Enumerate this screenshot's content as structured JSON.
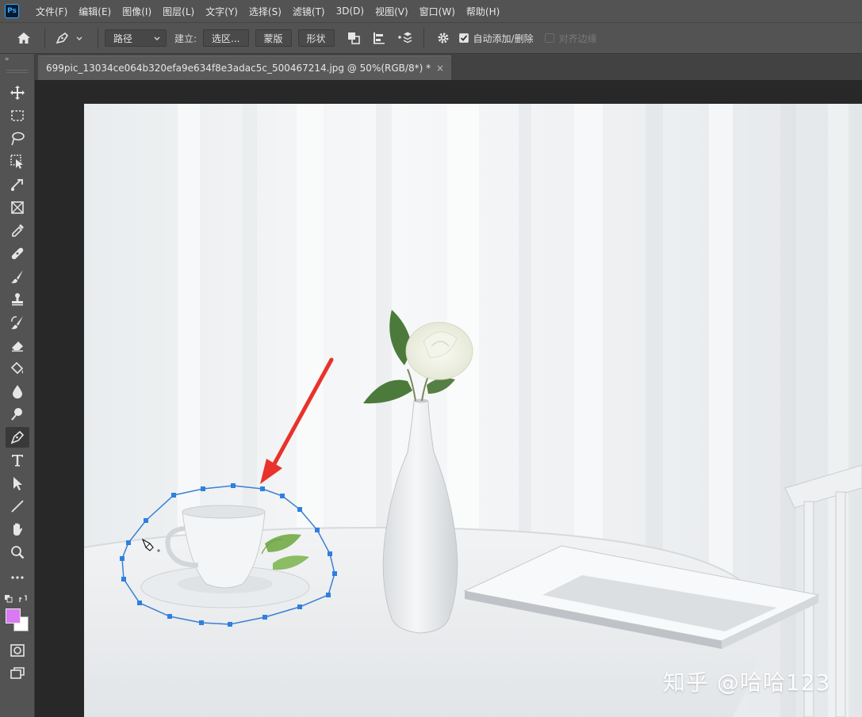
{
  "app": {
    "logo": "Ps",
    "accent": "#31a8ff"
  },
  "menu": [
    "文件(F)",
    "编辑(E)",
    "图像(I)",
    "图层(L)",
    "文字(Y)",
    "选择(S)",
    "滤镜(T)",
    "3D(D)",
    "视图(V)",
    "窗口(W)",
    "帮助(H)"
  ],
  "options": {
    "mode_select": "路径",
    "build_label": "建立:",
    "selection_button": "选区...",
    "mask_button": "蒙版",
    "shape_button": "形状",
    "auto_add_delete_label": "自动添加/删除",
    "auto_add_delete_checked": true,
    "align_edges_label": "对齐边缘",
    "align_edges_checked": false
  },
  "toolbar": {
    "collapse_label": "»",
    "tools": [
      "move-tool-icon",
      "marquee-tool-icon",
      "lasso-tool-icon",
      "object-selection-tool-icon",
      "crop-tool-icon",
      "frame-tool-icon",
      "eyedropper-tool-icon",
      "healing-brush-tool-icon",
      "brush-tool-icon",
      "clone-stamp-tool-icon",
      "history-brush-tool-icon",
      "eraser-tool-icon",
      "paint-bucket-tool-icon",
      "blur-tool-icon",
      "dodge-tool-icon",
      "pen-tool-icon",
      "type-tool-icon",
      "path-selection-tool-icon",
      "line-tool-icon",
      "hand-tool-icon",
      "zoom-tool-icon",
      "more-tools-icon"
    ],
    "active_tool": "pen-tool-icon",
    "foreground_color": "#d97af2",
    "background_color": "#ffffff"
  },
  "document": {
    "tab_title": "699pic_13034ce064b320efa9e634f8e3adac5c_500467214.jpg @ 50%(RGB/8*) *",
    "close_glyph": "×"
  },
  "path_color": "#3a7fd4",
  "arrow_color": "#e8322b",
  "watermark": "知乎 @哈哈123"
}
